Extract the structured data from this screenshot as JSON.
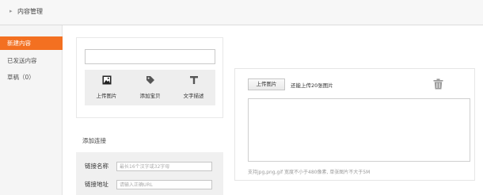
{
  "header": {
    "title": "内容管理",
    "icon": "caret-right-icon"
  },
  "sidebar": {
    "items": [
      {
        "label": "新建内容",
        "active": true
      },
      {
        "label": "已发送内容",
        "active": false
      },
      {
        "label": "草稿（0）",
        "active": false
      }
    ]
  },
  "editor": {
    "title_value": "",
    "tools": [
      {
        "label": "上传图片",
        "icon": "image-icon"
      },
      {
        "label": "添加宝贝",
        "icon": "tag-icon"
      },
      {
        "label": "文字描述",
        "icon": "text-icon"
      }
    ]
  },
  "links": {
    "section_title": "添加连接",
    "name_label": "链接名称",
    "name_placeholder": "最长16个汉字或32字母",
    "url_label": "链接地址",
    "url_placeholder": "请输入正确URL"
  },
  "upload": {
    "button_label": "上传图片",
    "hint": "还能上传20张图片",
    "support": "支持jpg,png,gif 宽度不小于480像素, 单张图片不大于5M",
    "delete_icon": "trash-icon"
  },
  "colors": {
    "accent": "#f37021",
    "sidebar_bg": "#f5f5f5",
    "toolbar_bg": "#eeeeee"
  }
}
